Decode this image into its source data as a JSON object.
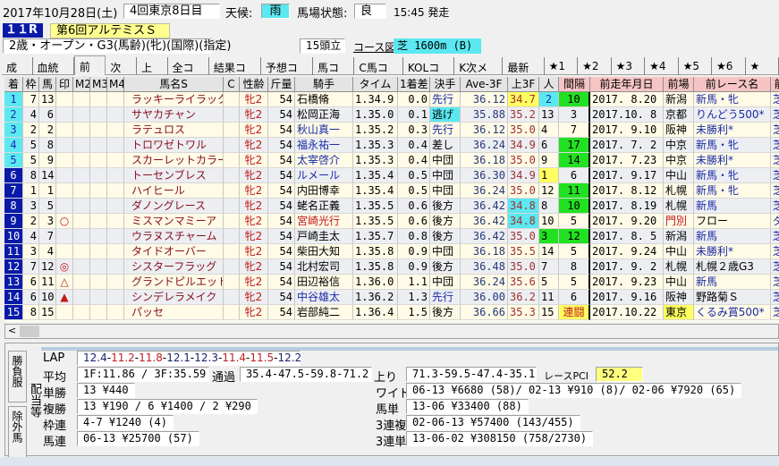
{
  "header": {
    "date": "2017年10月28日(土)",
    "meeting": "4回東京8日目",
    "weather_label": "天候:",
    "weather": "雨",
    "track_label": "馬場状態:",
    "track": "良",
    "post_time": "15:45 発走",
    "race_no": "１１R",
    "race_name": "第6回アルテミスＳ",
    "race_class": "2歳・オープン・G3(馬齢)(牝)(国際)(指定)",
    "runners": "15頭立",
    "course_link": "コース図",
    "course": "芝 1600m (B)"
  },
  "tabs": [
    "成績",
    "血統他",
    "前走",
    "次走",
    "上り",
    "全コメ",
    "結果コメ",
    "予想コメ",
    "馬コメ",
    "C馬コメ",
    "KOLコメ",
    "K次メモ",
    "最新成",
    "★1",
    "★2",
    "★3",
    "★4",
    "★5",
    "★6",
    "★"
  ],
  "active_tab": "前走",
  "columns": [
    "着",
    "枠",
    "馬",
    "印",
    "M2",
    "M3",
    "M4",
    "馬名S",
    "C",
    "性齢",
    "斤量",
    "騎手",
    "タイム",
    "1着差",
    "決手",
    "Ave-3F",
    "上3F",
    "人",
    "間隔",
    "前走年月日",
    "前場",
    "前レース名",
    "前"
  ],
  "rows": [
    {
      "pos": "1",
      "waku": "7",
      "num": "13",
      "mark": "",
      "name": "ラッキーライラック",
      "sex": "牝2",
      "wt": "54",
      "jockey": "石橋脩",
      "jc": "",
      "time": "1.34.9",
      "diff": "0.0",
      "style": "先行",
      "sc": "blue",
      "ave": "36.12",
      "l3f": "34.7",
      "lh": "yellow",
      "pop": "2",
      "ph": "cyan",
      "int": "10",
      "ih": "green",
      "pdate": "2017. 8.20",
      "pplace": "新潟",
      "plc": "",
      "prace": "新馬・牝",
      "prc": "blue",
      "pcourse": "芝"
    },
    {
      "pos": "2",
      "waku": "4",
      "num": "6",
      "mark": "",
      "name": "サヤカチャン",
      "sex": "牝2",
      "wt": "54",
      "jockey": "松岡正海",
      "jc": "",
      "time": "1.35.0",
      "diff": "0.1",
      "style": "逃げ",
      "sc": "cyanbg",
      "ave": "35.88",
      "l3f": "35.2",
      "lh": "",
      "pop": "13",
      "ph": "",
      "int": "3",
      "ih": "",
      "pdate": "2017.10. 8",
      "pplace": "京都",
      "plc": "",
      "prace": "りんどう500*",
      "prc": "blue",
      "pcourse": "芝"
    },
    {
      "pos": "3",
      "waku": "2",
      "num": "2",
      "mark": "",
      "name": "ラテュロス",
      "sex": "牝2",
      "wt": "54",
      "jockey": "秋山真一",
      "jc": "blue",
      "time": "1.35.2",
      "diff": "0.3",
      "style": "先行",
      "sc": "blue",
      "ave": "36.12",
      "l3f": "35.0",
      "lh": "",
      "pop": "4",
      "ph": "",
      "int": "7",
      "ih": "",
      "pdate": "2017. 9.10",
      "pplace": "阪神",
      "plc": "",
      "prace": "未勝利*",
      "prc": "blue",
      "pcourse": "芝"
    },
    {
      "pos": "4",
      "waku": "5",
      "num": "8",
      "mark": "",
      "name": "トロワゼトワル",
      "sex": "牝2",
      "wt": "54",
      "jockey": "福永祐一",
      "jc": "blue",
      "time": "1.35.3",
      "diff": "0.4",
      "style": "差し",
      "sc": "",
      "ave": "36.24",
      "l3f": "34.9",
      "lh": "",
      "pop": "6",
      "ph": "",
      "int": "17",
      "ih": "green",
      "pdate": "2017. 7. 2",
      "pplace": "中京",
      "plc": "",
      "prace": "新馬・牝",
      "prc": "blue",
      "pcourse": "芝"
    },
    {
      "pos": "5",
      "waku": "5",
      "num": "9",
      "mark": "",
      "name": "スカーレットカラー",
      "sex": "牝2",
      "wt": "54",
      "jockey": "太宰啓介",
      "jc": "blue",
      "time": "1.35.3",
      "diff": "0.4",
      "style": "中団",
      "sc": "",
      "ave": "36.18",
      "l3f": "35.0",
      "lh": "",
      "pop": "9",
      "ph": "",
      "int": "14",
      "ih": "green",
      "pdate": "2017. 7.23",
      "pplace": "中京",
      "plc": "",
      "prace": "未勝利*",
      "prc": "blue",
      "pcourse": "芝"
    },
    {
      "pos": "6",
      "waku": "8",
      "num": "14",
      "mark": "",
      "name": "トーセンブレス",
      "sex": "牝2",
      "wt": "54",
      "jockey": "ルメール",
      "jc": "blue",
      "time": "1.35.4",
      "diff": "0.5",
      "style": "中団",
      "sc": "",
      "ave": "36.30",
      "l3f": "34.9",
      "lh": "",
      "pop": "1",
      "ph": "yellow",
      "int": "6",
      "ih": "",
      "pdate": "2017. 9.17",
      "pplace": "中山",
      "plc": "",
      "prace": "新馬・牝",
      "prc": "blue",
      "pcourse": "芝"
    },
    {
      "pos": "7",
      "waku": "1",
      "num": "1",
      "mark": "",
      "name": "ハイヒール",
      "sex": "牝2",
      "wt": "54",
      "jockey": "内田博幸",
      "jc": "",
      "time": "1.35.4",
      "diff": "0.5",
      "style": "中団",
      "sc": "",
      "ave": "36.24",
      "l3f": "35.0",
      "lh": "",
      "pop": "12",
      "ph": "",
      "int": "11",
      "ih": "green",
      "pdate": "2017. 8.12",
      "pplace": "札幌",
      "plc": "",
      "prace": "新馬・牝",
      "prc": "blue",
      "pcourse": "芝"
    },
    {
      "pos": "8",
      "waku": "3",
      "num": "5",
      "mark": "",
      "name": "ダノングレース",
      "sex": "牝2",
      "wt": "54",
      "jockey": "蛯名正義",
      "jc": "",
      "time": "1.35.5",
      "diff": "0.6",
      "style": "後方",
      "sc": "",
      "ave": "36.42",
      "l3f": "34.8",
      "lh": "cyan",
      "pop": "8",
      "ph": "",
      "int": "10",
      "ih": "green",
      "pdate": "2017. 8.19",
      "pplace": "札幌",
      "plc": "",
      "prace": "新馬",
      "prc": "blue",
      "pcourse": "芝"
    },
    {
      "pos": "9",
      "waku": "2",
      "num": "3",
      "mark": "○",
      "name": "ミスマンマミーア",
      "sex": "牝2",
      "wt": "54",
      "jockey": "宮崎光行",
      "jc": "red",
      "time": "1.35.5",
      "diff": "0.6",
      "style": "後方",
      "sc": "",
      "ave": "36.42",
      "l3f": "34.8",
      "lh": "cyan",
      "pop": "10",
      "ph": "",
      "int": "5",
      "ih": "",
      "pdate": "2017. 9.20",
      "pplace": "門別",
      "plc": "red",
      "prace": "フロー",
      "prc": "",
      "pcourse": "ダ"
    },
    {
      "pos": "10",
      "waku": "4",
      "num": "7",
      "mark": "",
      "name": "ウラヌスチャーム",
      "sex": "牝2",
      "wt": "54",
      "jockey": "戸崎圭太",
      "jc": "",
      "time": "1.35.7",
      "diff": "0.8",
      "style": "後方",
      "sc": "",
      "ave": "36.42",
      "l3f": "35.0",
      "lh": "",
      "pop": "3",
      "ph": "green",
      "int": "12",
      "ih": "green",
      "pdate": "2017. 8. 5",
      "pplace": "新潟",
      "plc": "",
      "prace": "新馬",
      "prc": "blue",
      "pcourse": "芝"
    },
    {
      "pos": "11",
      "waku": "3",
      "num": "4",
      "mark": "",
      "name": "タイドオーバー",
      "sex": "牝2",
      "wt": "54",
      "jockey": "柴田大知",
      "jc": "",
      "time": "1.35.8",
      "diff": "0.9",
      "style": "中団",
      "sc": "",
      "ave": "36.18",
      "l3f": "35.5",
      "lh": "",
      "pop": "14",
      "ph": "",
      "int": "5",
      "ih": "",
      "pdate": "2017. 9.24",
      "pplace": "中山",
      "plc": "",
      "prace": "未勝利*",
      "prc": "blue",
      "pcourse": "芝"
    },
    {
      "pos": "12",
      "waku": "7",
      "num": "12",
      "mark": "◎",
      "name": "シスターフラッグ",
      "sex": "牝2",
      "wt": "54",
      "jockey": "北村宏司",
      "jc": "",
      "time": "1.35.8",
      "diff": "0.9",
      "style": "後方",
      "sc": "",
      "ave": "36.48",
      "l3f": "35.0",
      "lh": "",
      "pop": "7",
      "ph": "",
      "int": "8",
      "ih": "",
      "pdate": "2017. 9. 2",
      "pplace": "札幌",
      "plc": "",
      "prace": "札幌２歳G3",
      "prc": "",
      "pcourse": "芝"
    },
    {
      "pos": "13",
      "waku": "6",
      "num": "11",
      "mark": "△",
      "name": "グランドピルエット",
      "sex": "牝2",
      "wt": "54",
      "jockey": "田辺裕信",
      "jc": "",
      "time": "1.36.0",
      "diff": "1.1",
      "style": "中団",
      "sc": "",
      "ave": "36.24",
      "l3f": "35.6",
      "lh": "",
      "pop": "5",
      "ph": "",
      "int": "5",
      "ih": "",
      "pdate": "2017. 9.23",
      "pplace": "中山",
      "plc": "",
      "prace": "新馬",
      "prc": "blue",
      "pcourse": "芝"
    },
    {
      "pos": "14",
      "waku": "6",
      "num": "10",
      "mark": "▲",
      "name": "シンデレラメイク",
      "sex": "牝2",
      "wt": "54",
      "jockey": "中谷雄太",
      "jc": "blue",
      "time": "1.36.2",
      "diff": "1.3",
      "style": "先行",
      "sc": "blue",
      "ave": "36.00",
      "l3f": "36.2",
      "lh": "",
      "pop": "11",
      "ph": "",
      "int": "6",
      "ih": "",
      "pdate": "2017. 9.16",
      "pplace": "阪神",
      "plc": "",
      "prace": "野路菊Ｓ",
      "prc": "",
      "pcourse": "芝"
    },
    {
      "pos": "15",
      "waku": "8",
      "num": "15",
      "mark": "",
      "name": "パッセ",
      "sex": "牝2",
      "wt": "54",
      "jockey": "岩部純二",
      "jc": "",
      "time": "1.36.4",
      "diff": "1.5",
      "style": "後方",
      "sc": "",
      "ave": "36.66",
      "l3f": "35.3",
      "lh": "",
      "pop": "15",
      "ph": "",
      "int": "連闘",
      "ih": "yellow",
      "pdate": "2017.10.22",
      "pplace": "東京",
      "plc": "yellowbg",
      "prace": "くるみ賞500*",
      "prc": "blue",
      "pcourse": "芝"
    }
  ],
  "bottom": {
    "side_tabs": [
      "勝負服",
      "除外馬"
    ],
    "group_label": "配当等",
    "lap_label": "LAP",
    "laps": [
      [
        "12.4",
        "n"
      ],
      [
        "11.2",
        "r"
      ],
      [
        "11.8",
        "r"
      ],
      [
        "12.1",
        "n"
      ],
      [
        "12.3",
        "n"
      ],
      [
        "11.4",
        "r"
      ],
      [
        "11.5",
        "r"
      ],
      [
        "12.2",
        "n"
      ]
    ],
    "avg_label": "平均",
    "avg": "1F:11.86 / 3F:35.59",
    "pass_label": "通過",
    "pass": "35.4-47.5-59.8-71.2",
    "agari_label": "上り",
    "agari": "71.3-59.5-47.4-35.1",
    "pci_label": "レースPCI",
    "pci": "52.2",
    "payouts": [
      {
        "label": "単勝",
        "value": "13 ¥440"
      },
      {
        "label": "複勝",
        "value": "13 ¥190 / 6 ¥1400 / 2 ¥290"
      },
      {
        "label": "枠連",
        "value": "4-7 ¥1240 (4)"
      },
      {
        "label": "馬連",
        "value": "06-13 ¥25700 (57)"
      }
    ],
    "payouts_right": [
      {
        "label": "ワイド",
        "value": "06-13 ¥6680 (58)/ 02-13 ¥910 (8)/ 02-06 ¥7920 (65)"
      },
      {
        "label": "馬単",
        "value": "13-06 ¥33400 (88)"
      },
      {
        "label": "3連複",
        "value": "02-06-13 ¥57400 (143/455)"
      },
      {
        "label": "3連単",
        "value": "13-06-02 ¥308150 (758/2730)"
      }
    ],
    "scroll_left": "<"
  },
  "colors": {
    "cyan": "#5ce8f0",
    "yellow": "#ffff60",
    "green": "#22e022",
    "navy": "#0a1aa8",
    "blue": "#1a2aa8",
    "red": "#c01818",
    "name": "#8a1020"
  }
}
